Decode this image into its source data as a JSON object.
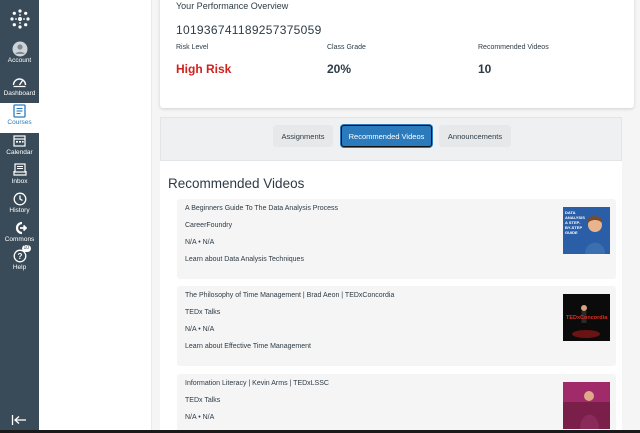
{
  "nav": {
    "items": [
      {
        "label": "Account",
        "icon": "account-icon"
      },
      {
        "label": "Dashboard",
        "icon": "dashboard-icon"
      },
      {
        "label": "Courses",
        "icon": "courses-icon"
      },
      {
        "label": "Calendar",
        "icon": "calendar-icon"
      },
      {
        "label": "Inbox",
        "icon": "inbox-icon"
      },
      {
        "label": "History",
        "icon": "history-icon"
      },
      {
        "label": "Commons",
        "icon": "commons-icon"
      },
      {
        "label": "Help",
        "icon": "help-icon",
        "badge": "10"
      }
    ],
    "active": "Courses",
    "colors": {
      "bg": "#394b58",
      "active_text": "#2b7abc"
    }
  },
  "performance": {
    "title": "Your Performance Overview",
    "student_id": "1019367411892573750​59",
    "risk_label": "Risk Level",
    "risk_value": "High Risk",
    "grade_label": "Class Grade",
    "grade_value": "20%",
    "videos_label": "Recommended Videos",
    "videos_value": "10",
    "risk_color": "#d0211c"
  },
  "tabs": [
    {
      "label": "Assignments",
      "active": false
    },
    {
      "label": "Recommended Videos",
      "active": true
    },
    {
      "label": "Announcements",
      "active": false
    }
  ],
  "section_title": "Recommended Videos",
  "videos": [
    {
      "title": "A Beginners Guide To The Data Analysis Process",
      "channel": "CareerFoundry",
      "meta": "N/A • N/A",
      "description": "Learn about Data Analysis Techniques",
      "thumb_text": "DATA ANALYSIS A STEP-BY-STEP GUIDE"
    },
    {
      "title": "The Philosophy of Time Management | Brad Aeon | TEDxConcordia",
      "channel": "TEDx Talks",
      "meta": "N/A • N/A",
      "description": "Learn about Effective Time Management",
      "thumb_text": "TEDxConcordia"
    },
    {
      "title": "Information Literacy | Kevin Arms | TEDxLSSC",
      "channel": "TEDx Talks",
      "meta": "N/A • N/A",
      "description": "",
      "thumb_text": ""
    }
  ]
}
